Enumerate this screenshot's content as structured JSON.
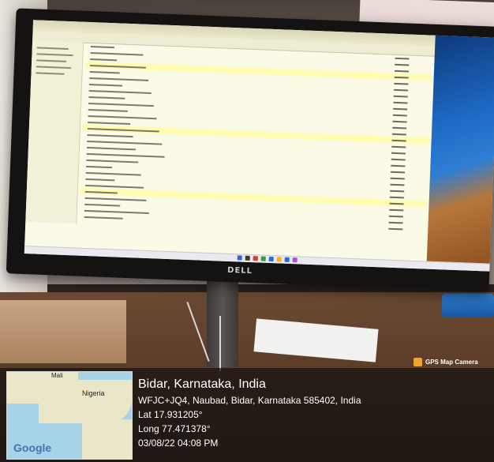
{
  "monitor": {
    "brand": "DELL"
  },
  "gps_badge": {
    "icon": "camera-icon",
    "label": "GPS Map Camera"
  },
  "map": {
    "country_top": "Mali",
    "country_label": "Nigeria",
    "provider": "Google"
  },
  "location": {
    "title": "Bidar, Karnataka, India",
    "address": "WFJC+JQ4, Naubad, Bidar, Karnataka 585402, India",
    "lat": "Lat 17.931205°",
    "long": "Long 77.471378°",
    "datetime": "03/08/22 04:08 PM"
  },
  "colors": {
    "overlay": "#141210",
    "badge": "#f2a531",
    "screen": "#f4f2d8",
    "wallpaper": "#1d68c3"
  }
}
